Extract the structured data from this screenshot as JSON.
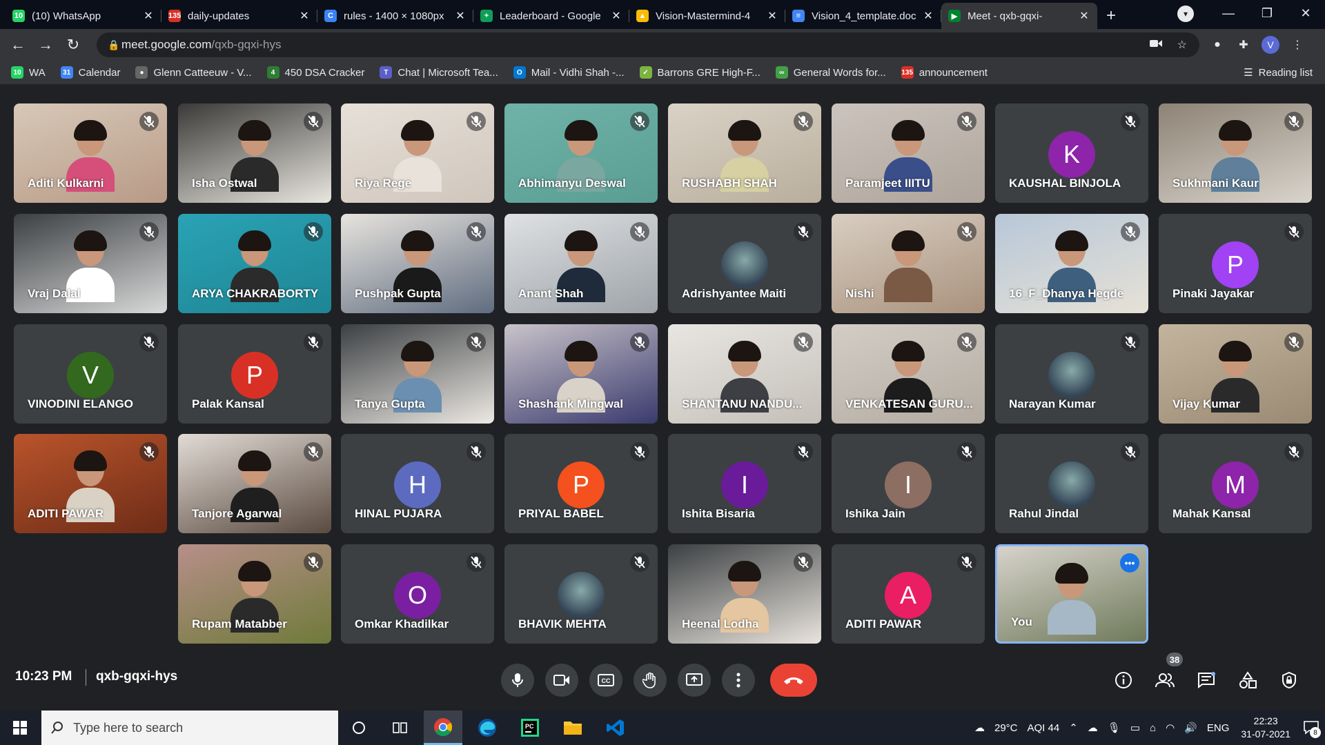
{
  "browser": {
    "tabs": [
      {
        "label": "(10) WhatsApp",
        "favicon": "whatsapp-icon",
        "color": "#25d366",
        "glyph": "10"
      },
      {
        "label": "daily-updates",
        "favicon": "mail-icon",
        "color": "#d93025",
        "glyph": "135"
      },
      {
        "label": "rules - 1400 × 1080px",
        "favicon": "canva-icon",
        "color": "#3b82f6",
        "glyph": "C"
      },
      {
        "label": "Leaderboard - Google",
        "favicon": "sheets-icon",
        "color": "#0f9d58",
        "glyph": "+"
      },
      {
        "label": "Vision-Mastermind-4",
        "favicon": "drive-icon",
        "color": "#fbbc04",
        "glyph": "▲"
      },
      {
        "label": "Vision_4_template.doc",
        "favicon": "docs-icon",
        "color": "#4285f4",
        "glyph": "≡"
      },
      {
        "label": "Meet - qxb-gqxi-",
        "favicon": "meet-icon",
        "color": "#00832d",
        "glyph": "▶",
        "active": true
      }
    ],
    "url_host": "meet.google.com",
    "url_path": "/qxb-gqxi-hys",
    "profile_initial": "V",
    "bookmarks": [
      {
        "label": "WA",
        "icon": "whatsapp-icon",
        "color": "#25d366",
        "glyph": "10"
      },
      {
        "label": "Calendar",
        "icon": "calendar-icon",
        "color": "#4285f4",
        "glyph": "31"
      },
      {
        "label": "Glenn Catteeuw - V...",
        "icon": "medium-icon",
        "color": "#666",
        "glyph": "●"
      },
      {
        "label": "450 DSA Cracker",
        "icon": "dsa-icon",
        "color": "#2e7d32",
        "glyph": "4"
      },
      {
        "label": "Chat | Microsoft Tea...",
        "icon": "teams-icon",
        "color": "#5b5fc7",
        "glyph": "T"
      },
      {
        "label": "Mail - Vidhi Shah -...",
        "icon": "outlook-icon",
        "color": "#0078d4",
        "glyph": "O"
      },
      {
        "label": "Barrons GRE High-F...",
        "icon": "check-icon",
        "color": "#7cb342",
        "glyph": "✓"
      },
      {
        "label": "General Words for...",
        "icon": "link-icon",
        "color": "#43a047",
        "glyph": "∞"
      },
      {
        "label": "announcement",
        "icon": "gmail-icon",
        "color": "#d93025",
        "glyph": "135"
      }
    ],
    "reading_list": "Reading list"
  },
  "participants": [
    {
      "name": "Aditi Kulkarni",
      "kind": "video",
      "c1": "#d7c8b8",
      "c2": "#b89a86",
      "shirt": "#d54f7a"
    },
    {
      "name": "Isha Ostwal",
      "kind": "video",
      "c1": "#3b3a38",
      "c2": "#e9e6e0",
      "shirt": "#2a2a2a"
    },
    {
      "name": "Riya Rege",
      "kind": "video",
      "c1": "#e7e0d8",
      "c2": "#cfc6bc",
      "shirt": "#e8e2da"
    },
    {
      "name": "Abhimanyu Deswal",
      "kind": "video",
      "c1": "#6fb3a8",
      "c2": "#5a9d93",
      "shirt": "#7aa7a0"
    },
    {
      "name": "RUSHABH SHAH",
      "kind": "video",
      "c1": "#d9d2c6",
      "c2": "#b9ae9d",
      "shirt": "#d6d0a2"
    },
    {
      "name": "Paramjeet IIITU",
      "kind": "video",
      "c1": "#cbc3bd",
      "c2": "#aea49b",
      "shirt": "#3a4f8a"
    },
    {
      "name": "KAUSHAL BINJOLA",
      "kind": "avatar",
      "letter": "K",
      "color": "#8e24aa"
    },
    {
      "name": "Sukhmani Kaur",
      "kind": "video",
      "c1": "#8d8275",
      "c2": "#d9d4cc",
      "shirt": "#5f7f9a"
    },
    {
      "name": "Vraj Dalal",
      "kind": "video",
      "c1": "#3c4043",
      "c2": "#d9d9d9",
      "shirt": "#ffffff"
    },
    {
      "name": "ARYA CHAKRABORTY",
      "kind": "video",
      "c1": "#2aa3b5",
      "c2": "#1e8594",
      "shirt": "#2b2b2b"
    },
    {
      "name": "Pushpak Gupta",
      "kind": "video",
      "c1": "#e8e4de",
      "c2": "#5f6c80",
      "shirt": "#1a1a1a"
    },
    {
      "name": "Anant Shah",
      "kind": "video",
      "c1": "#dfe1e3",
      "c2": "#9da3a8",
      "shirt": "#1f2a3a"
    },
    {
      "name": "Adrishyantee Maiti",
      "kind": "photo"
    },
    {
      "name": "Nishi",
      "kind": "video",
      "c1": "#d8cec2",
      "c2": "#a9927d",
      "shirt": "#7a5a44"
    },
    {
      "name": "16_F_Dhanya Hegde",
      "kind": "video",
      "c1": "#b7c7d8",
      "c2": "#e6e1d6",
      "shirt": "#3f5f7f"
    },
    {
      "name": "Pinaki Jayakar",
      "kind": "avatar",
      "letter": "P",
      "color": "#a142f4"
    },
    {
      "name": "VINODINI ELANGO",
      "kind": "avatar",
      "letter": "V",
      "color": "#33691e"
    },
    {
      "name": "Palak Kansal",
      "kind": "avatar",
      "letter": "P",
      "color": "#d93025"
    },
    {
      "name": "Tanya Gupta",
      "kind": "video",
      "c1": "#3c4043",
      "c2": "#ede9e4",
      "shirt": "#6b8fb0"
    },
    {
      "name": "Shashank Mingwal",
      "kind": "video",
      "c1": "#c9c3c9",
      "c2": "#3a3a6e",
      "shirt": "#d8d2c8"
    },
    {
      "name": "SHANTANU NANDU...",
      "kind": "video",
      "c1": "#e8e6e2",
      "c2": "#c4bfb8",
      "shirt": "#3d3f44"
    },
    {
      "name": "VENKATESAN GURU...",
      "kind": "video",
      "c1": "#d3cdc6",
      "c2": "#b3aba1",
      "shirt": "#1c1c1c"
    },
    {
      "name": "Narayan Kumar",
      "kind": "photo"
    },
    {
      "name": "Vijay Kumar",
      "kind": "video",
      "c1": "#c3b49d",
      "c2": "#9a8a74",
      "shirt": "#2a2a2a"
    },
    {
      "name": "ADITI PAWAR",
      "kind": "video",
      "c1": "#b9542b",
      "c2": "#6e2c17",
      "shirt": "#d9d1c3"
    },
    {
      "name": "Tanjore Agarwal",
      "kind": "video",
      "c1": "#e2dcd6",
      "c2": "#5a4a40",
      "shirt": "#1f1f1f"
    },
    {
      "name": "HINAL PUJARA",
      "kind": "avatar",
      "letter": "H",
      "color": "#5c6bc0"
    },
    {
      "name": "PRIYAL BABEL",
      "kind": "avatar",
      "letter": "P",
      "color": "#f4511e"
    },
    {
      "name": "Ishita Bisaria",
      "kind": "avatar",
      "letter": "I",
      "color": "#6a1b9a"
    },
    {
      "name": "Ishika Jain",
      "kind": "avatar",
      "letter": "I",
      "color": "#8d6e63"
    },
    {
      "name": "Rahul Jindal",
      "kind": "photo"
    },
    {
      "name": "Mahak Kansal",
      "kind": "avatar",
      "letter": "M",
      "color": "#8e24aa"
    },
    {
      "name": "Rupam Matabber",
      "kind": "video",
      "c1": "#b78f8a",
      "c2": "#6f7a3a",
      "shirt": "#2a2a2a"
    },
    {
      "name": "Omkar Khadilkar",
      "kind": "avatar",
      "letter": "O",
      "color": "#7b1fa2"
    },
    {
      "name": "BHAVIK MEHTA",
      "kind": "photo"
    },
    {
      "name": "Heenal Lodha",
      "kind": "video",
      "c1": "#3c4043",
      "c2": "#e9e4dd",
      "shirt": "#e4c6a0"
    },
    {
      "name": "ADITI PAWAR",
      "kind": "avatar",
      "letter": "A",
      "color": "#e91e63"
    },
    {
      "name": "You",
      "kind": "self",
      "c1": "#d7d3cc",
      "c2": "#6f7a5a",
      "shirt": "#a6b8c6"
    }
  ],
  "meet": {
    "time": "10:23 PM",
    "meeting_code": "qxb-gqxi-hys",
    "people_count": "38",
    "controls": [
      "microphone-icon",
      "camera-icon",
      "captions-icon",
      "raise-hand-icon",
      "present-icon",
      "more-options-icon"
    ],
    "right_controls": [
      "info-icon",
      "people-icon",
      "chat-icon",
      "activities-icon",
      "host-controls-icon"
    ]
  },
  "taskbar": {
    "search_placeholder": "Type here to search",
    "weather": "29°C",
    "aqi": "AQI 44",
    "language": "ENG",
    "time": "22:23",
    "date": "31-07-2021",
    "notifications": "8"
  },
  "colors": {
    "meet_bg": "#202124",
    "tile_bg": "#3c4043",
    "hangup": "#ea4335",
    "self_border": "#8ab4f8"
  }
}
